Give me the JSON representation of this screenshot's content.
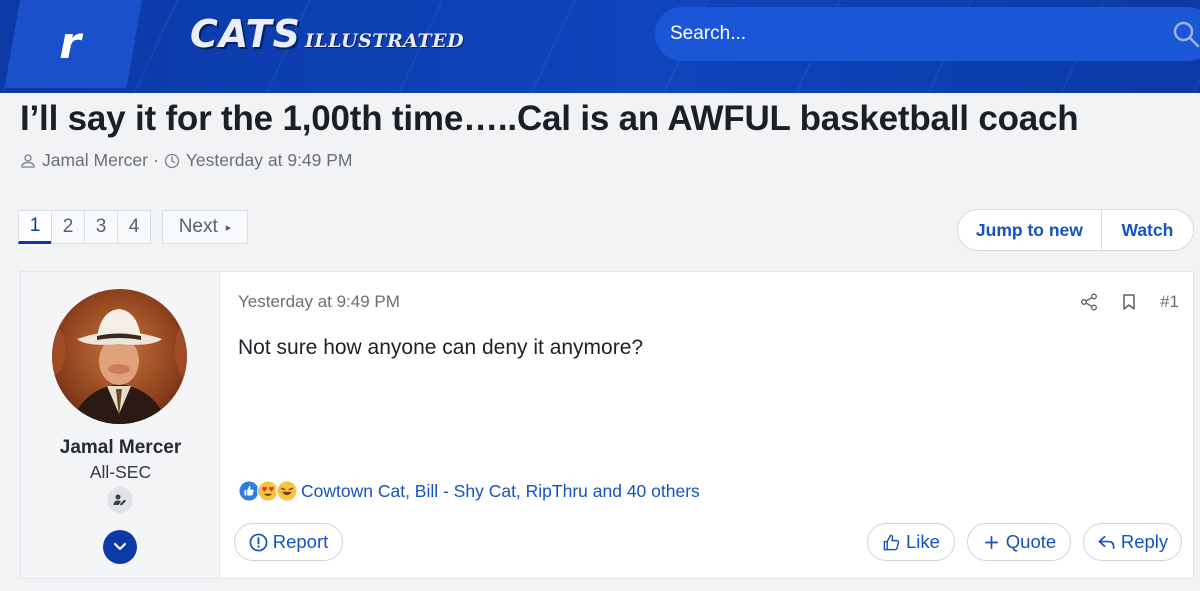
{
  "header": {
    "rivals_badge": "r",
    "logo_main": "CATS",
    "logo_sub": "ILLUSTRATED",
    "search_placeholder": "Search...",
    "search_icon": "search-icon"
  },
  "thread": {
    "title": "I’ll say it for the 1,00th time…..Cal is an AWFUL basketball coach",
    "author": "Jamal Mercer",
    "separator": "·",
    "date": "Yesterday at 9:49 PM"
  },
  "pagination": {
    "pages": [
      "1",
      "2",
      "3",
      "4"
    ],
    "current": "1",
    "next_label": "Next",
    "next_chevron": "▸"
  },
  "thread_actions": {
    "jump_label": "Jump to new",
    "watch_label": "Watch"
  },
  "post": {
    "user": {
      "name": "Jamal Mercer",
      "title": "All-SEC"
    },
    "date": "Yesterday at 9:49 PM",
    "number": "#1",
    "content": "Not sure how anyone can deny it anymore?",
    "reactions": {
      "icons": [
        "like-reaction",
        "love-reaction",
        "laugh-reaction"
      ],
      "text": "Cowtown Cat, Bill - Shy Cat, RipThru and 40 others"
    },
    "buttons": {
      "report": "Report",
      "like": "Like",
      "quote": "Quote",
      "reply": "Reply"
    }
  },
  "colors": {
    "header_blue": "#0b3aa6",
    "search_blue": "#1a56d6",
    "link_blue": "#1553c1",
    "page_bg": "#f2f3f5"
  }
}
